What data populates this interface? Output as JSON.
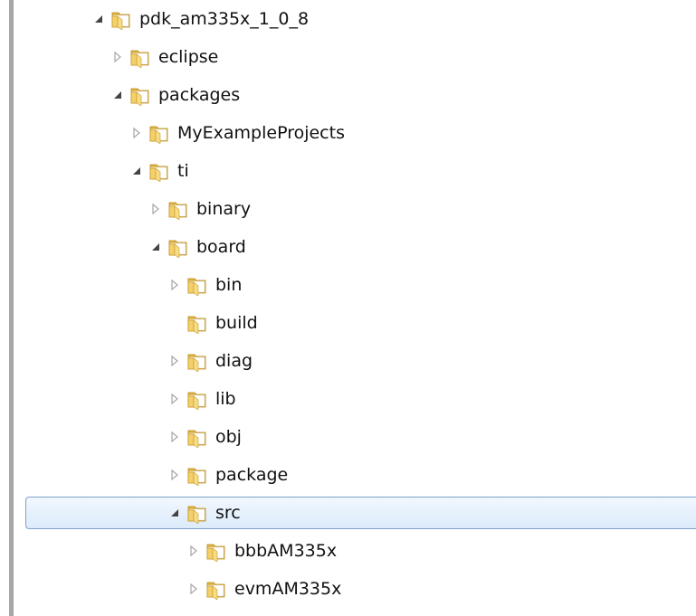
{
  "colors": {
    "selection_border": "#7da2ce",
    "selection_fill_top": "#f2f7fd",
    "selection_fill_bottom": "#dcebfc",
    "folder_yellow": "#f4d06b",
    "arrow_expanded": "#444444",
    "arrow_collapsed": "#a6a6a6",
    "border_left": "#a7a7a7"
  },
  "tree": {
    "items": [
      {
        "label": "pdk_am335x_1_0_8",
        "depth": 0,
        "state": "expanded",
        "selected": false
      },
      {
        "label": "eclipse",
        "depth": 1,
        "state": "collapsed",
        "selected": false
      },
      {
        "label": "packages",
        "depth": 1,
        "state": "expanded",
        "selected": false
      },
      {
        "label": "MyExampleProjects",
        "depth": 2,
        "state": "collapsed",
        "selected": false
      },
      {
        "label": "ti",
        "depth": 2,
        "state": "expanded",
        "selected": false
      },
      {
        "label": "binary",
        "depth": 3,
        "state": "collapsed",
        "selected": false
      },
      {
        "label": "board",
        "depth": 3,
        "state": "expanded",
        "selected": false
      },
      {
        "label": "bin",
        "depth": 4,
        "state": "collapsed",
        "selected": false
      },
      {
        "label": "build",
        "depth": 4,
        "state": "none",
        "selected": false
      },
      {
        "label": "diag",
        "depth": 4,
        "state": "collapsed",
        "selected": false
      },
      {
        "label": "lib",
        "depth": 4,
        "state": "collapsed",
        "selected": false
      },
      {
        "label": "obj",
        "depth": 4,
        "state": "collapsed",
        "selected": false
      },
      {
        "label": "package",
        "depth": 4,
        "state": "collapsed",
        "selected": false
      },
      {
        "label": "src",
        "depth": 4,
        "state": "expanded",
        "selected": true
      },
      {
        "label": "bbbAM335x",
        "depth": 5,
        "state": "collapsed",
        "selected": false
      },
      {
        "label": "evmAM335x",
        "depth": 5,
        "state": "collapsed",
        "selected": false
      }
    ]
  }
}
